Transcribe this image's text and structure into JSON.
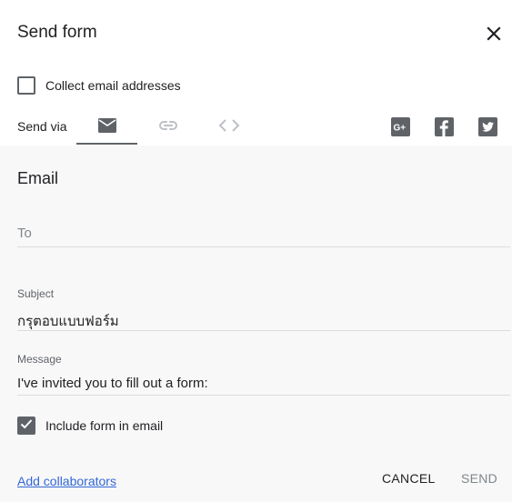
{
  "dialog": {
    "title": "Send form",
    "close_icon": "close-icon"
  },
  "collect": {
    "label": "Collect email addresses",
    "checked": false
  },
  "send_via": {
    "label": "Send via",
    "tabs": [
      {
        "name": "email",
        "icon": "email-icon",
        "selected": true
      },
      {
        "name": "link",
        "icon": "link-icon",
        "selected": false
      },
      {
        "name": "embed",
        "icon": "embed-code-icon",
        "selected": false
      }
    ],
    "social": [
      {
        "name": "google-plus",
        "icon": "google-plus-icon"
      },
      {
        "name": "facebook",
        "icon": "facebook-icon"
      },
      {
        "name": "twitter",
        "icon": "twitter-icon"
      }
    ]
  },
  "email": {
    "section_title": "Email",
    "to_placeholder": "To",
    "to_value": "",
    "subject_label": "Subject",
    "subject_value": "กรุตอบแบบฟอร์ม",
    "message_label": "Message",
    "message_value": "I've invited you to fill out a form:",
    "include_label": "Include form in email",
    "include_checked": true
  },
  "footer": {
    "add_collaborators": "Add collaborators",
    "cancel": "CANCEL",
    "send": "SEND"
  },
  "colors": {
    "icon_active": "#5f6368",
    "icon_inactive": "#bdc1c6",
    "link": "#3367d6",
    "body_bg": "#f8f8f8"
  }
}
